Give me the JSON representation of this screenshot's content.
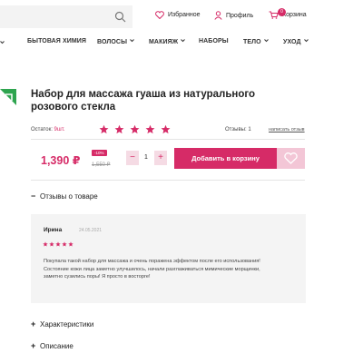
{
  "header": {
    "favorites_label": "Избранное",
    "profile_label": "Профиль",
    "cart_label": "Корзина",
    "cart_count": "0"
  },
  "nav": {
    "items": [
      {
        "label": "БЫТОВАЯ ХИМИЯ",
        "has_dropdown": false
      },
      {
        "label": "ВОЛОСЫ",
        "has_dropdown": true
      },
      {
        "label": "МАКИЯЖ",
        "has_dropdown": true
      },
      {
        "label": "НАБОРЫ",
        "has_dropdown": false
      },
      {
        "label": "ТЕЛО",
        "has_dropdown": true
      },
      {
        "label": "УХОД",
        "has_dropdown": true
      }
    ]
  },
  "product": {
    "title": "Набор для массажа гуаша из натурального розового стекла",
    "rating": 5,
    "stock_label": "Остаток:",
    "stock_value": "9шт.",
    "reviews_label": "Отзывы:",
    "reviews_count": "1",
    "write_review": "написать отзыв",
    "price": "1,390 ₽",
    "discount": "-10%",
    "old_price": "1,550 ₽",
    "quantity": "1",
    "minus": "−",
    "plus": "+",
    "add_to_cart": "Добавить в корзину"
  },
  "sections": {
    "reviews": {
      "label": "Отзывы о товаре",
      "symbol": "−"
    },
    "characteristics": {
      "label": "Характеристики",
      "symbol": "+"
    },
    "description": {
      "label": "Описание",
      "symbol": "+"
    }
  },
  "review": {
    "author": "Ирина",
    "date": "24.05.2021",
    "rating": 5,
    "text": "Покупала такой набор для массажа и очень поражена эффектом после его использования! Состояние кожи лица заметно улучшилось, начали разглаживаться мимические морщинки, заметно сузились поры! Я просто в восторге!"
  },
  "colors": {
    "accent": "#d62b67",
    "accent_light": "#f3c6d6",
    "green": "#2ea44f"
  }
}
